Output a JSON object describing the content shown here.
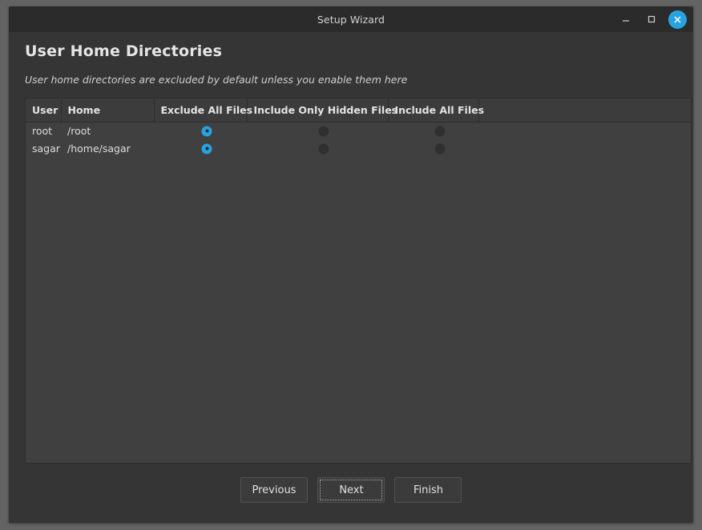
{
  "window": {
    "title": "Setup Wizard",
    "controls": {
      "minimize_label": "Minimize",
      "maximize_label": "Maximize",
      "close_label": "Close"
    },
    "accent_color": "#27a3e0"
  },
  "page": {
    "title": "User Home Directories",
    "subtitle": "User home directories are excluded by default unless you enable them here"
  },
  "table": {
    "columns": [
      {
        "key": "user",
        "label": "User"
      },
      {
        "key": "home",
        "label": "Home"
      },
      {
        "key": "exclude_all",
        "label": "Exclude All Files"
      },
      {
        "key": "include_hidden",
        "label": "Include Only Hidden Files"
      },
      {
        "key": "include_all",
        "label": "Include All Files"
      }
    ],
    "rows": [
      {
        "user": "root",
        "home": "/root",
        "exclude_all": true,
        "include_hidden": false,
        "include_all": false
      },
      {
        "user": "sagar",
        "home": "/home/sagar",
        "exclude_all": true,
        "include_hidden": false,
        "include_all": false
      }
    ]
  },
  "footer": {
    "previous_label": "Previous",
    "next_label": "Next",
    "finish_label": "Finish",
    "focused_button": "Next"
  }
}
